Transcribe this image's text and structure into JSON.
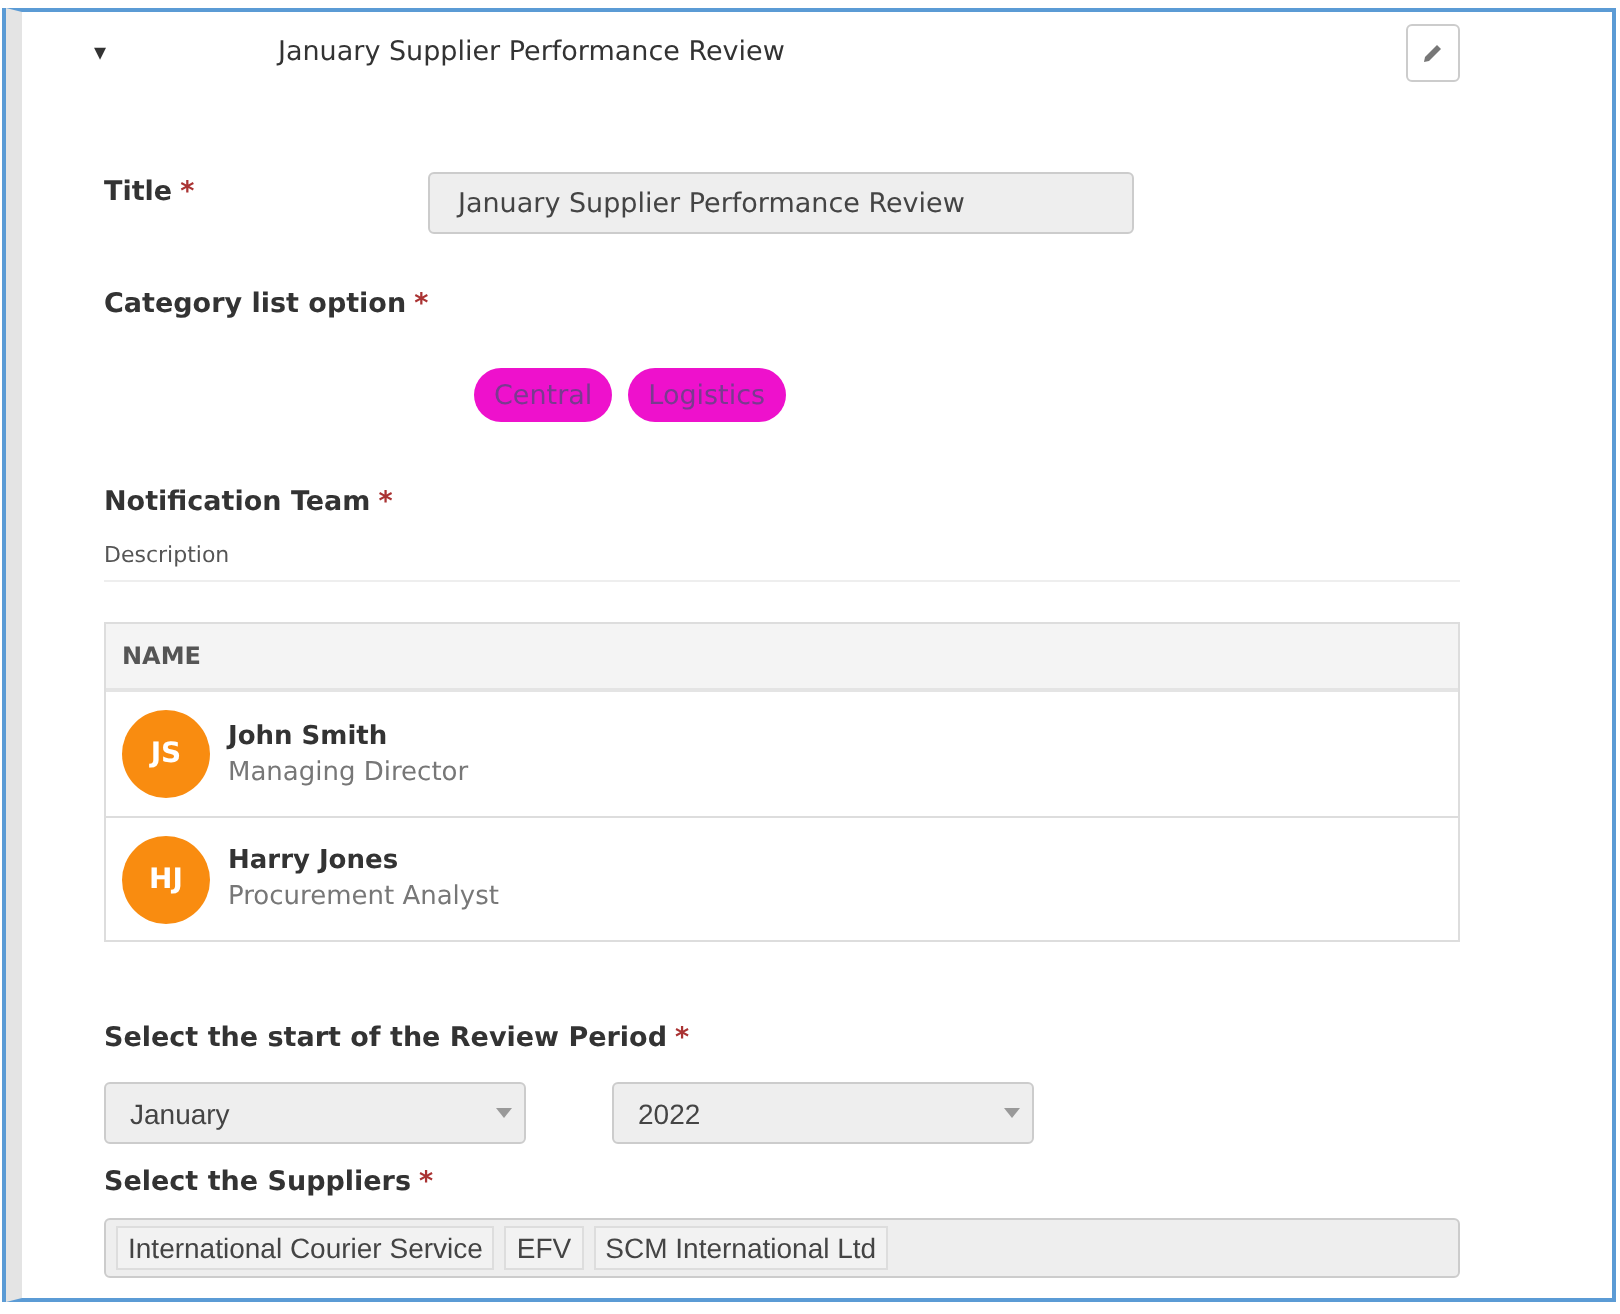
{
  "header": {
    "caret": "▾",
    "title": "January Supplier Performance Review"
  },
  "title_field": {
    "label": "Title",
    "required_mark": "*",
    "value": "January Supplier Performance Review"
  },
  "category": {
    "label": "Category list option",
    "required_mark": "*",
    "tags": [
      {
        "label": "Central",
        "color": "#ee11cc"
      },
      {
        "label": "Logistics",
        "color": "#ee11cc"
      }
    ]
  },
  "notification_team": {
    "label": "Notification Team",
    "required_mark": "*",
    "description": "Description",
    "table": {
      "columns": [
        "NAME"
      ],
      "rows": [
        {
          "initials": "JS",
          "name": "John Smith",
          "role": "Managing Director"
        },
        {
          "initials": "HJ",
          "name": "Harry Jones",
          "role": "Procurement Analyst"
        }
      ]
    }
  },
  "review_period": {
    "label": "Select the start of the Review Period",
    "required_mark": "*",
    "selects": [
      {
        "value": "January"
      },
      {
        "value": "2022"
      }
    ]
  },
  "suppliers": {
    "label": "Select the Suppliers",
    "required_mark": "*",
    "chips": [
      "International Courier Service",
      "EFV",
      "SCM International Ltd"
    ]
  }
}
